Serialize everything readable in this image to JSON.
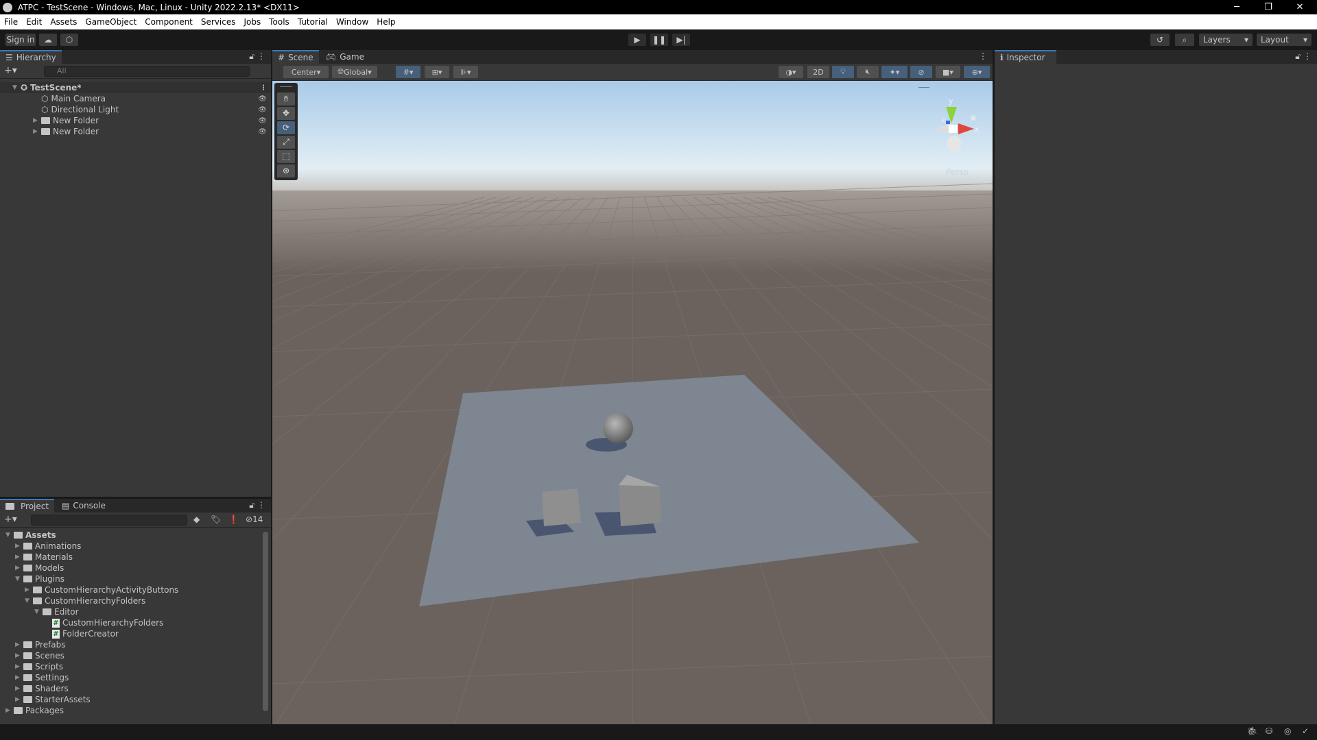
{
  "window": {
    "title": "ATPC - TestScene - Windows, Mac, Linux - Unity 2022.2.13* <DX11>",
    "minimize": "─",
    "maximize": "❐",
    "close": "✕"
  },
  "menu": [
    "File",
    "Edit",
    "Assets",
    "GameObject",
    "Component",
    "Services",
    "Jobs",
    "Tools",
    "Tutorial",
    "Window",
    "Help"
  ],
  "toolbar": {
    "sign_in": "Sign in",
    "layers": "Layers",
    "layout": "Layout"
  },
  "hierarchy": {
    "tab": "Hierarchy",
    "search_placeholder": "All",
    "scene": "TestScene*",
    "items": [
      "Main Camera",
      "Directional Light",
      "New Folder",
      "New Folder"
    ]
  },
  "scene": {
    "tabs": [
      "Scene",
      "Game"
    ],
    "pivot": "Center",
    "space": "Global",
    "mode_2d": "2D",
    "persp": "Persp",
    "gizmo_axes": {
      "x": "x",
      "y": "y",
      "z": "z"
    },
    "colors": {
      "sky": "#a9cbe9",
      "ground": "#6b625d",
      "plane": "#7d8691",
      "x": "#e0463b",
      "y": "#8fd13b",
      "z": "#3a6be0"
    }
  },
  "inspector": {
    "tab": "Inspector"
  },
  "project": {
    "tabs": [
      "Project",
      "Console"
    ],
    "hidden_count": "14",
    "tree": [
      {
        "label": "Assets",
        "depth": 0,
        "open": true,
        "bold": true,
        "type": "folder"
      },
      {
        "label": "Animations",
        "depth": 1,
        "type": "folder"
      },
      {
        "label": "Materials",
        "depth": 1,
        "type": "folder"
      },
      {
        "label": "Models",
        "depth": 1,
        "type": "folder"
      },
      {
        "label": "Plugins",
        "depth": 1,
        "open": true,
        "type": "folder"
      },
      {
        "label": "CustomHierarchyActivityButtons",
        "depth": 2,
        "type": "folder"
      },
      {
        "label": "CustomHierarchyFolders",
        "depth": 2,
        "open": true,
        "type": "folder"
      },
      {
        "label": "Editor",
        "depth": 3,
        "open": true,
        "type": "folder"
      },
      {
        "label": "CustomHierarchyFolders",
        "depth": 4,
        "type": "script"
      },
      {
        "label": "FolderCreator",
        "depth": 4,
        "type": "script"
      },
      {
        "label": "Prefabs",
        "depth": 1,
        "type": "folder"
      },
      {
        "label": "Scenes",
        "depth": 1,
        "type": "folder"
      },
      {
        "label": "Scripts",
        "depth": 1,
        "type": "folder"
      },
      {
        "label": "Settings",
        "depth": 1,
        "type": "folder"
      },
      {
        "label": "Shaders",
        "depth": 1,
        "type": "folder"
      },
      {
        "label": "StarterAssets",
        "depth": 1,
        "type": "folder"
      },
      {
        "label": "Packages",
        "depth": 0,
        "type": "folder"
      }
    ]
  }
}
